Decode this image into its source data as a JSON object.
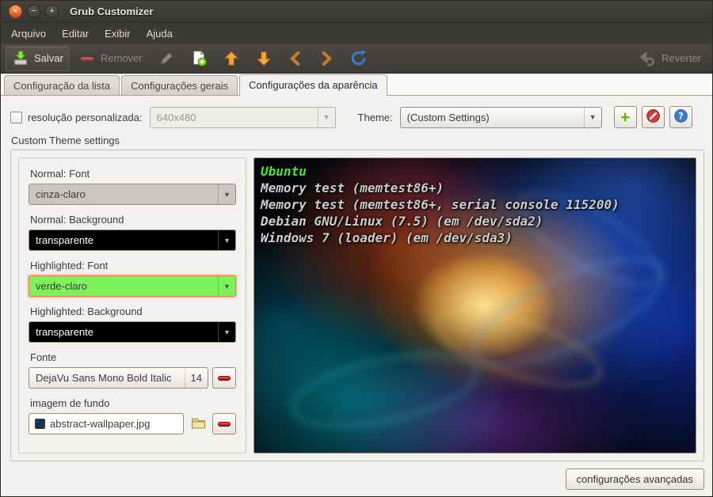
{
  "window": {
    "title": "Grub Customizer"
  },
  "menubar": {
    "items": [
      {
        "label": "Arquivo"
      },
      {
        "label": "Editar"
      },
      {
        "label": "Exibir"
      },
      {
        "label": "Ajuda"
      }
    ]
  },
  "toolbar": {
    "save": "Salvar",
    "remove": "Remover",
    "revert": "Reverter"
  },
  "tabs": [
    {
      "label": "Configuração da lista"
    },
    {
      "label": "Configurações gerais"
    },
    {
      "label": "Configurações da aparência"
    }
  ],
  "settings": {
    "resolution": {
      "label": "resolução personalizada:",
      "value": "640x480",
      "checked": false
    },
    "theme": {
      "label": "Theme:",
      "value": "(Custom Settings)"
    }
  },
  "custom_theme": {
    "frame_title": "Custom Theme settings",
    "normal_font": {
      "label": "Normal: Font",
      "value": "cinza-claro",
      "swatch": "#c9c5c0"
    },
    "normal_background": {
      "label": "Normal: Background",
      "value": "transparente",
      "swatch": "#000000"
    },
    "highlighted_font": {
      "label": "Highlighted: Font",
      "value": "verde-claro",
      "swatch": "#7df25e"
    },
    "highlighted_background": {
      "label": "Highlighted: Background",
      "value": "transparente",
      "swatch": "#000000"
    },
    "font": {
      "label": "Fonte",
      "value": "DejaVu Sans Mono Bold Italic",
      "size": "14"
    },
    "background_image": {
      "label": "imagem de fundo",
      "value": "abstract-wallpaper.jpg"
    }
  },
  "preview": {
    "entries": [
      {
        "text": "Ubuntu",
        "highlighted": true
      },
      {
        "text": "Memory test (memtest86+)",
        "highlighted": false
      },
      {
        "text": "Memory test (memtest86+, serial console 115200)",
        "highlighted": false
      },
      {
        "text": "Debian GNU/Linux (7.5) (em /dev/sda2)",
        "highlighted": false
      },
      {
        "text": "Windows 7 (loader) (em /dev/sda3)",
        "highlighted": false
      }
    ],
    "colors": {
      "highlight_font": "#3df02c",
      "normal_font": "#cdcdcd"
    }
  },
  "footer": {
    "advanced": "configurações avançadas"
  }
}
